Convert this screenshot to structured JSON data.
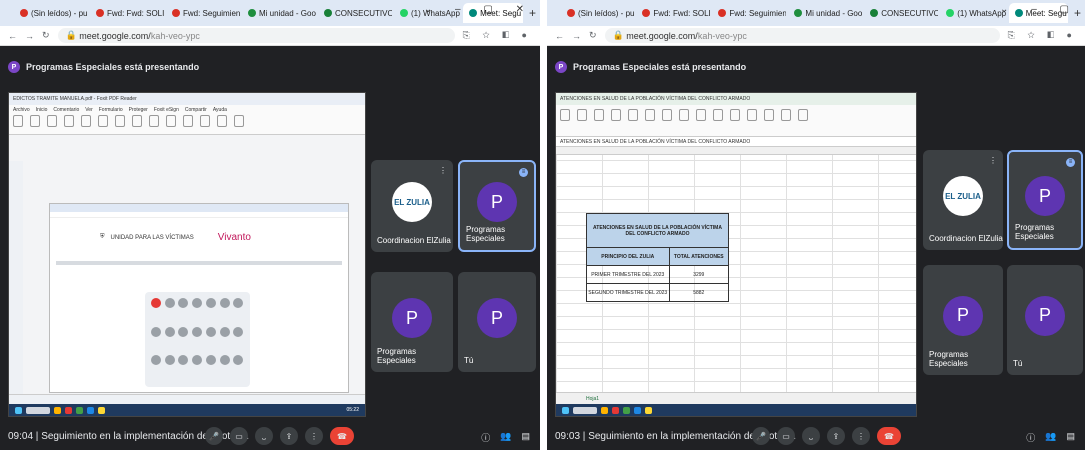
{
  "left": {
    "tabs": [
      {
        "label": "(Sin leídos) - pu",
        "color": "#d93025"
      },
      {
        "label": "Fwd: Fwd: SOLI(",
        "color": "#d93025"
      },
      {
        "label": "Fwd: Seguimient",
        "color": "#d93025"
      },
      {
        "label": "Mi unidad - Goo",
        "color": "#1e8e3e"
      },
      {
        "label": "CONSECUTIVO",
        "color": "#188038"
      },
      {
        "label": "(1) WhatsApp",
        "color": "#25d366"
      },
      {
        "label": "Meet: Segu",
        "color": "#00897b",
        "active": true
      }
    ],
    "url": "meet.google.com/",
    "url_suffix": "kah-veo-ypc",
    "presenting_banner": "Programas Especiales está presentando",
    "presenter_initial": "P",
    "pdf": {
      "title": "EDICTOS TRAMITE MANUELA.pdf - Foxit PDF Reader",
      "menu": [
        "Archivo",
        "Inicio",
        "Comentario",
        "Ver",
        "Formulario",
        "Proteger",
        "Foxit eSign",
        "Compartir",
        "Ayuda"
      ],
      "logo_text": "UNIDAD PARA LAS VÍCTIMAS",
      "brand": "Vivanto",
      "time": "05:22"
    },
    "tiles": [
      {
        "name": "Coordinacion ElZulia",
        "avatar": "EL ZULIA"
      },
      {
        "name": "Programas Especiales",
        "avatar": "P"
      },
      {
        "name": "Programas Especiales",
        "avatar": "P"
      },
      {
        "name": "Tú",
        "avatar": "P"
      }
    ],
    "bottom": {
      "time": "09:04",
      "title": "Seguimiento en la implementación del protoc..."
    }
  },
  "right": {
    "tabs": [
      {
        "label": "(Sin leídos) - pu",
        "color": "#d93025"
      },
      {
        "label": "Fwd: Fwd: SOLI(",
        "color": "#d93025"
      },
      {
        "label": "Fwd: Seguimient",
        "color": "#d93025"
      },
      {
        "label": "Mi unidad - Goo",
        "color": "#1e8e3e"
      },
      {
        "label": "CONSECUTIVO",
        "color": "#188038"
      },
      {
        "label": "(1) WhatsApp",
        "color": "#25d366"
      },
      {
        "label": "Meet: Segu",
        "color": "#00897b",
        "active": true
      }
    ],
    "url": "meet.google.com/",
    "url_suffix": "kah-veo-ypc",
    "presenting_banner": "Programas Especiales está presentando",
    "presenter_initial": "P",
    "excel": {
      "title": "ATENCIONES EN SALUD DE LA POBLACIÓN VÍCTIMA DEL CONFLICTO ARMADO",
      "table_title": "ATENCIONES EN SALUD DE LA POBLACIÓN VÍCTIMA DEL CONFLICTO ARMADO",
      "headers": [
        "PRINCIPIO DEL ZULIA",
        "TOTAL ATENCIONES"
      ],
      "rows": [
        [
          "PRIMER TRIMESTRE DEL 2023",
          "3299"
        ],
        [
          "SEGUNDO TRIMESTRE DEL 2023",
          "5882"
        ]
      ],
      "sheet": "Hoja1"
    },
    "tiles": [
      {
        "name": "Coordinacion ElZulia",
        "avatar": "EL ZULIA"
      },
      {
        "name": "Programas Especiales",
        "avatar": "P"
      },
      {
        "name": "Programas Especiales",
        "avatar": "P"
      },
      {
        "name": "Tú",
        "avatar": "P"
      }
    ],
    "bottom": {
      "time": "09:03",
      "title": "Seguimiento en la implementación del protoc..."
    }
  }
}
